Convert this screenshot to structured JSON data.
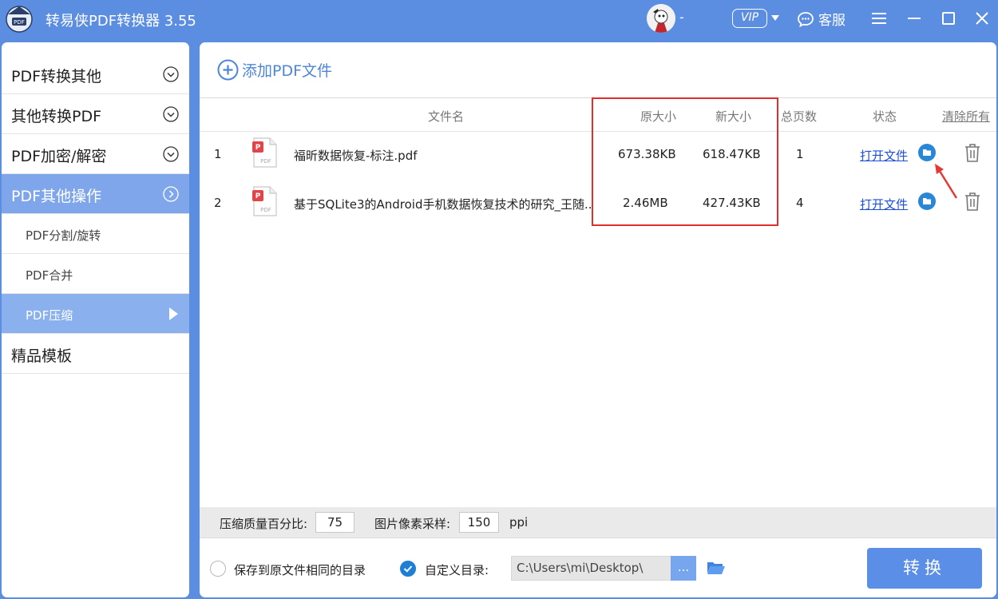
{
  "app": {
    "title": "转易侠PDF转换器 3.55",
    "user_name": "-",
    "vip_label": "VIP",
    "service_label": "客服"
  },
  "sidebar": {
    "categories": [
      {
        "label": "PDF转换其他"
      },
      {
        "label": "其他转换PDF"
      },
      {
        "label": "PDF加密/解密"
      },
      {
        "label": "PDF其他操作"
      }
    ],
    "subitems": [
      {
        "label": "PDF分割/旋转"
      },
      {
        "label": "PDF合并"
      },
      {
        "label": "PDF压缩"
      }
    ],
    "templates": {
      "label": "精品模板"
    }
  },
  "main": {
    "add_label": "添加PDF文件",
    "headers": {
      "filename": "文件名",
      "original_size": "原大小",
      "new_size": "新大小",
      "pages": "总页数",
      "status": "状态",
      "clear_all": "清除所有"
    },
    "rows": [
      {
        "index": "1",
        "name": "福昕数据恢复-标注.pdf",
        "original_size": "673.38KB",
        "new_size": "618.47KB",
        "pages": "1",
        "status": "打开文件"
      },
      {
        "index": "2",
        "name": "基于SQLite3的Android手机数据恢复技术的研究_王随..",
        "original_size": "2.46MB",
        "new_size": "427.43KB",
        "pages": "4",
        "status": "打开文件"
      }
    ]
  },
  "settings": {
    "quality_label": "压缩质量百分比:",
    "quality_value": "75",
    "sampling_label": "图片像素采样:",
    "sampling_value": "150",
    "sampling_unit": "ppi",
    "save_same_label": "保存到原文件相同的目录",
    "custom_dir_label": "自定义目录:",
    "dir_path": "C:\\Users\\mi\\Desktop\\",
    "browse_label": "...",
    "convert_label": "转换"
  },
  "colors": {
    "accent": "#5b8de0",
    "highlight_border": "#e02d2d",
    "link": "#1a4fd6"
  }
}
